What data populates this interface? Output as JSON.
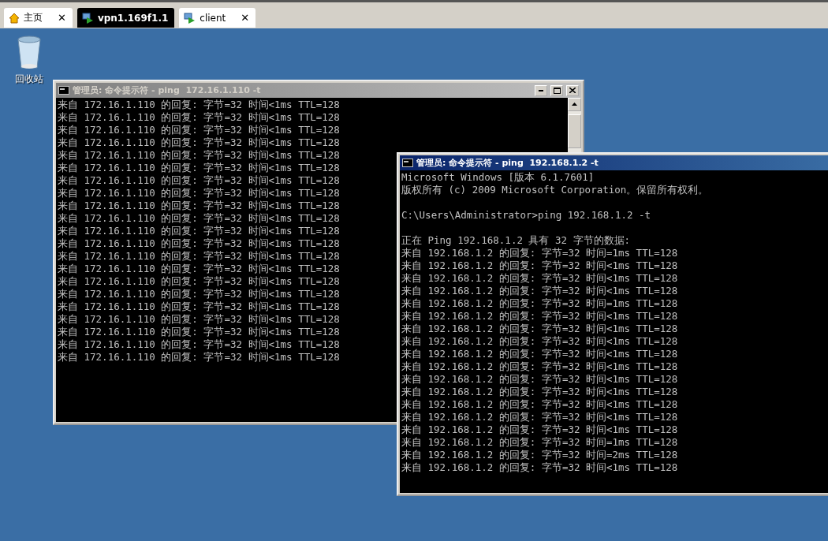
{
  "tabs": [
    {
      "label": "主页",
      "kind": "home",
      "selected": false,
      "close": "✕"
    },
    {
      "label": "vpn1.169f1.1",
      "kind": "remote",
      "selected": true
    },
    {
      "label": "client",
      "kind": "remote",
      "selected": false,
      "close": "✕"
    }
  ],
  "desktop_icons": [
    {
      "label": "回收站"
    }
  ],
  "windows": [
    {
      "title": "管理员: 命令提示符 - ping  172.16.1.110 -t",
      "active": false,
      "lines": [
        "来自 172.16.1.110 的回复: 字节=32 时间<1ms TTL=128",
        "来自 172.16.1.110 的回复: 字节=32 时间<1ms TTL=128",
        "来自 172.16.1.110 的回复: 字节=32 时间<1ms TTL=128",
        "来自 172.16.1.110 的回复: 字节=32 时间<1ms TTL=128",
        "来自 172.16.1.110 的回复: 字节=32 时间<1ms TTL=128",
        "来自 172.16.1.110 的回复: 字节=32 时间<1ms TTL=128",
        "来自 172.16.1.110 的回复: 字节=32 时间<1ms TTL=128",
        "来自 172.16.1.110 的回复: 字节=32 时间<1ms TTL=128",
        "来自 172.16.1.110 的回复: 字节=32 时间<1ms TTL=128",
        "来自 172.16.1.110 的回复: 字节=32 时间<1ms TTL=128",
        "来自 172.16.1.110 的回复: 字节=32 时间<1ms TTL=128",
        "来自 172.16.1.110 的回复: 字节=32 时间<1ms TTL=128",
        "来自 172.16.1.110 的回复: 字节=32 时间<1ms TTL=128",
        "来自 172.16.1.110 的回复: 字节=32 时间<1ms TTL=128",
        "来自 172.16.1.110 的回复: 字节=32 时间<1ms TTL=128",
        "来自 172.16.1.110 的回复: 字节=32 时间<1ms TTL=128",
        "来自 172.16.1.110 的回复: 字节=32 时间<1ms TTL=128",
        "来自 172.16.1.110 的回复: 字节=32 时间<1ms TTL=128",
        "来自 172.16.1.110 的回复: 字节=32 时间<1ms TTL=128",
        "来自 172.16.1.110 的回复: 字节=32 时间<1ms TTL=128",
        "来自 172.16.1.110 的回复: 字节=32 时间<1ms TTL=128"
      ]
    },
    {
      "title": "管理员: 命令提示符 - ping  192.168.1.2 -t",
      "active": true,
      "header": [
        "Microsoft Windows [版本 6.1.7601]",
        "版权所有 (c) 2009 Microsoft Corporation。保留所有权利。"
      ],
      "command": "C:\\Users\\Administrator>ping 192.168.1.2 -t",
      "intro": "正在 Ping 192.168.1.2 具有 32 字节的数据:",
      "lines": [
        "来自 192.168.1.2 的回复: 字节=32 时间=1ms TTL=128",
        "来自 192.168.1.2 的回复: 字节=32 时间<1ms TTL=128",
        "来自 192.168.1.2 的回复: 字节=32 时间<1ms TTL=128",
        "来自 192.168.1.2 的回复: 字节=32 时间<1ms TTL=128",
        "来自 192.168.1.2 的回复: 字节=32 时间=1ms TTL=128",
        "来自 192.168.1.2 的回复: 字节=32 时间<1ms TTL=128",
        "来自 192.168.1.2 的回复: 字节=32 时间<1ms TTL=128",
        "来自 192.168.1.2 的回复: 字节=32 时间<1ms TTL=128",
        "来自 192.168.1.2 的回复: 字节=32 时间<1ms TTL=128",
        "来自 192.168.1.2 的回复: 字节=32 时间<1ms TTL=128",
        "来自 192.168.1.2 的回复: 字节=32 时间<1ms TTL=128",
        "来自 192.168.1.2 的回复: 字节=32 时间<1ms TTL=128",
        "来自 192.168.1.2 的回复: 字节=32 时间<1ms TTL=128",
        "来自 192.168.1.2 的回复: 字节=32 时间<1ms TTL=128",
        "来自 192.168.1.2 的回复: 字节=32 时间<1ms TTL=128",
        "来自 192.168.1.2 的回复: 字节=32 时间=1ms TTL=128",
        "来自 192.168.1.2 的回复: 字节=32 时间=2ms TTL=128",
        "来自 192.168.1.2 的回复: 字节=32 时间<1ms TTL=128"
      ]
    }
  ]
}
